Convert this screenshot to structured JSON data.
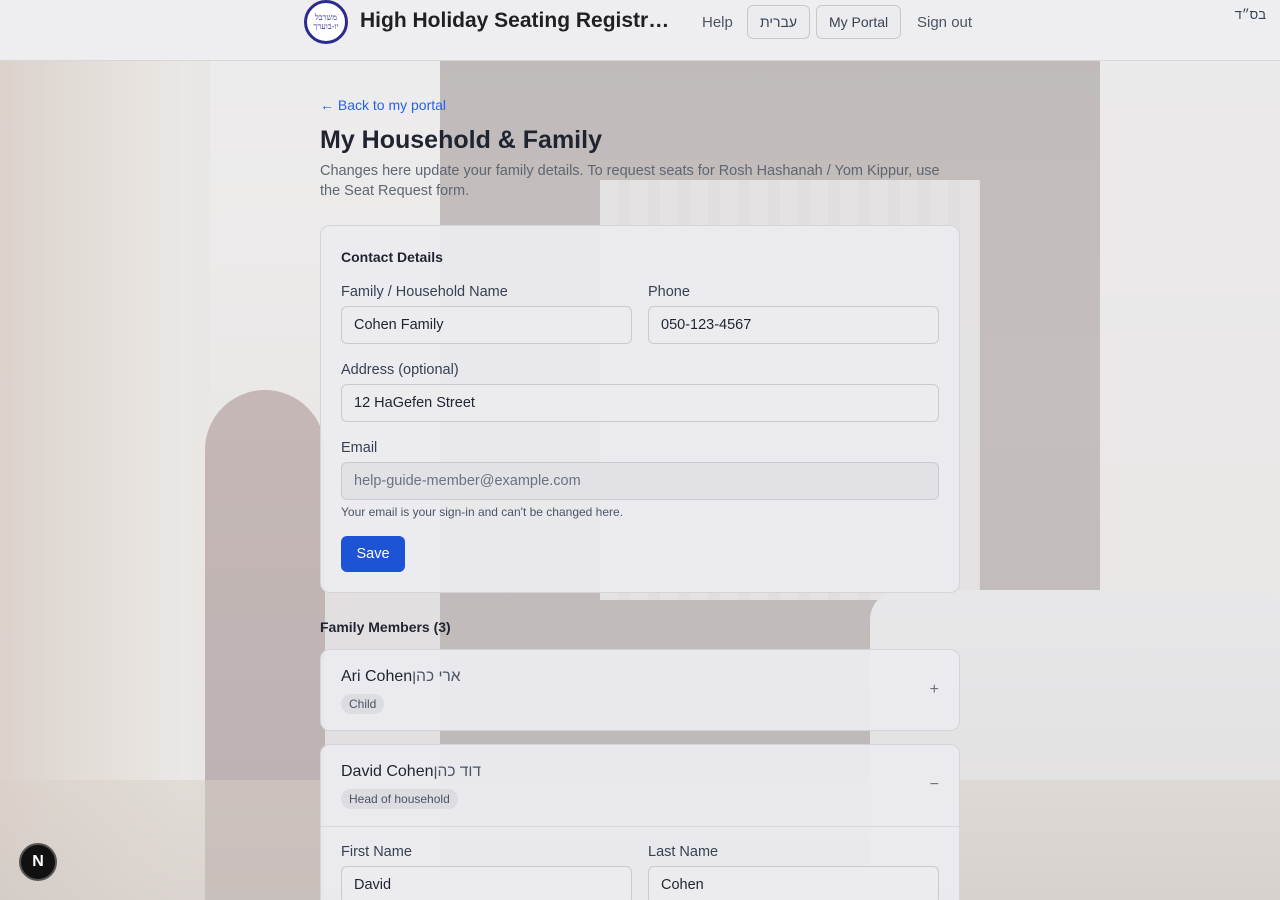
{
  "header": {
    "logo_text": "משרבל יו-בוערך",
    "title": "High Holiday Seating Registrati…",
    "nav_help": "Help",
    "nav_hebrew": "עברית",
    "nav_portal": "My Portal",
    "nav_signout": "Sign out",
    "bsd": "בס״ד"
  },
  "page": {
    "back_link": "← Back to my portal",
    "title": "My Household & Family",
    "description": "Changes here update your family details. To request seats for Rosh Hashanah / Yom Kippur, use the Seat Request form."
  },
  "contact": {
    "heading": "Contact Details",
    "family_label": "Family / Household Name",
    "family_value": "Cohen Family",
    "phone_label": "Phone",
    "phone_value": "050-123-4567",
    "address_label": "Address (optional)",
    "address_value": "12 HaGefen Street",
    "email_label": "Email",
    "email_value": "help-guide-member@example.com",
    "email_help": "Your email is your sign-in and can't be changed here.",
    "save_label": "Save"
  },
  "members": {
    "heading": "Family Members (3)",
    "items": [
      {
        "name": "Ari Cohen",
        "hebrew": "ארי כהן",
        "role": "Child",
        "toggle": "+"
      },
      {
        "name": "David Cohen",
        "hebrew": "דוד כהן",
        "role": "Head of household",
        "toggle": "−",
        "first_name_label": "First Name",
        "first_name_value": "David",
        "last_name_label": "Last Name",
        "last_name_value": "Cohen"
      }
    ]
  },
  "dev_badge": "N",
  "colors": {
    "primary": "#1d54d6",
    "link": "#2563eb",
    "logo": "#2b2a8f"
  }
}
